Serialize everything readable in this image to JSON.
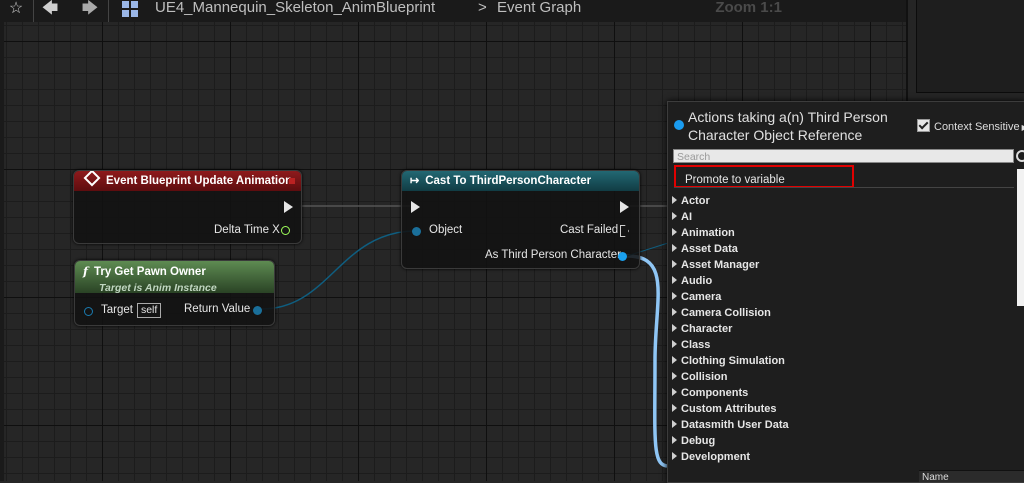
{
  "toolbar": {
    "breadcrumb_asset": "UE4_Mannequin_Skeleton_AnimBlueprint",
    "breadcrumb_sep": ">",
    "breadcrumb_graph": "Event Graph",
    "zoom": "Zoom 1:1"
  },
  "nodes": {
    "event": {
      "title": "Event Blueprint Update Animation",
      "pin_delta": "Delta Time X",
      "header_color": "#7d1416"
    },
    "cast": {
      "title": "Cast To ThirdPersonCharacter",
      "pin_object": "Object",
      "pin_cast_failed": "Cast Failed",
      "pin_as": "As Third Person Character",
      "header_color": "#1c5560"
    },
    "pawn": {
      "title": "Try Get Pawn Owner",
      "subtitle": "Target is Anim Instance",
      "pin_target": "Target",
      "pin_self": "self",
      "pin_return": "Return Value",
      "header_color": "#3b5e34"
    }
  },
  "menu": {
    "title": "Actions taking a(n) Third Person Character Object Reference",
    "context_sensitive": "Context Sensitive",
    "search_placeholder": "Search",
    "promote": "Promote to variable",
    "categories": [
      "Actor",
      "AI",
      "Animation",
      "Asset Data",
      "Asset Manager",
      "Audio",
      "Camera",
      "Camera Collision",
      "Character",
      "Class",
      "Clothing Simulation",
      "Collision",
      "Components",
      "Custom Attributes",
      "Datasmith User Data",
      "Debug",
      "Development"
    ]
  },
  "panel": {
    "bottom_label": "Name"
  }
}
